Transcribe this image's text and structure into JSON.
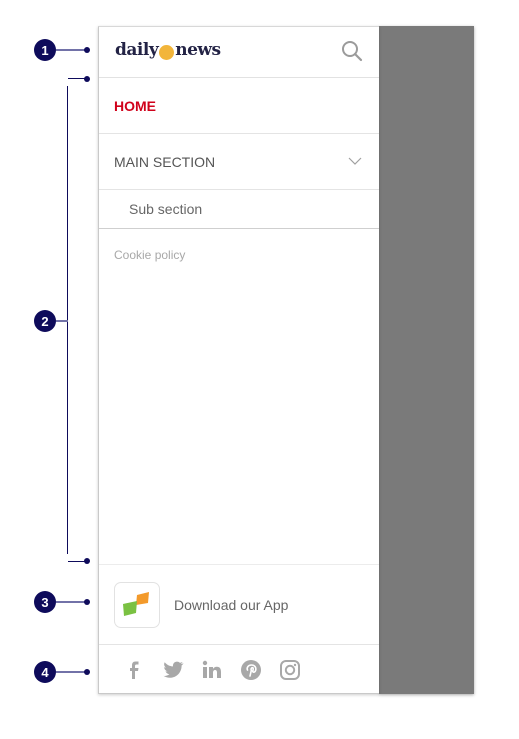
{
  "header": {
    "logo_left": "daily",
    "logo_right": "news",
    "search_icon": "search-icon"
  },
  "menu": {
    "home_label": "HOME",
    "main_section_label": "MAIN SECTION",
    "sub_section_label": "Sub section",
    "cookie_label": "Cookie policy"
  },
  "app": {
    "label": "Download our App"
  },
  "social": [
    "facebook-icon",
    "twitter-icon",
    "linkedin-icon",
    "pinterest-icon",
    "instagram-icon"
  ],
  "callouts": [
    "1",
    "2",
    "3",
    "4"
  ],
  "colors": {
    "accent": "#d0021b",
    "callout": "#0e0b5b",
    "overlay": "#7a7a7a"
  }
}
